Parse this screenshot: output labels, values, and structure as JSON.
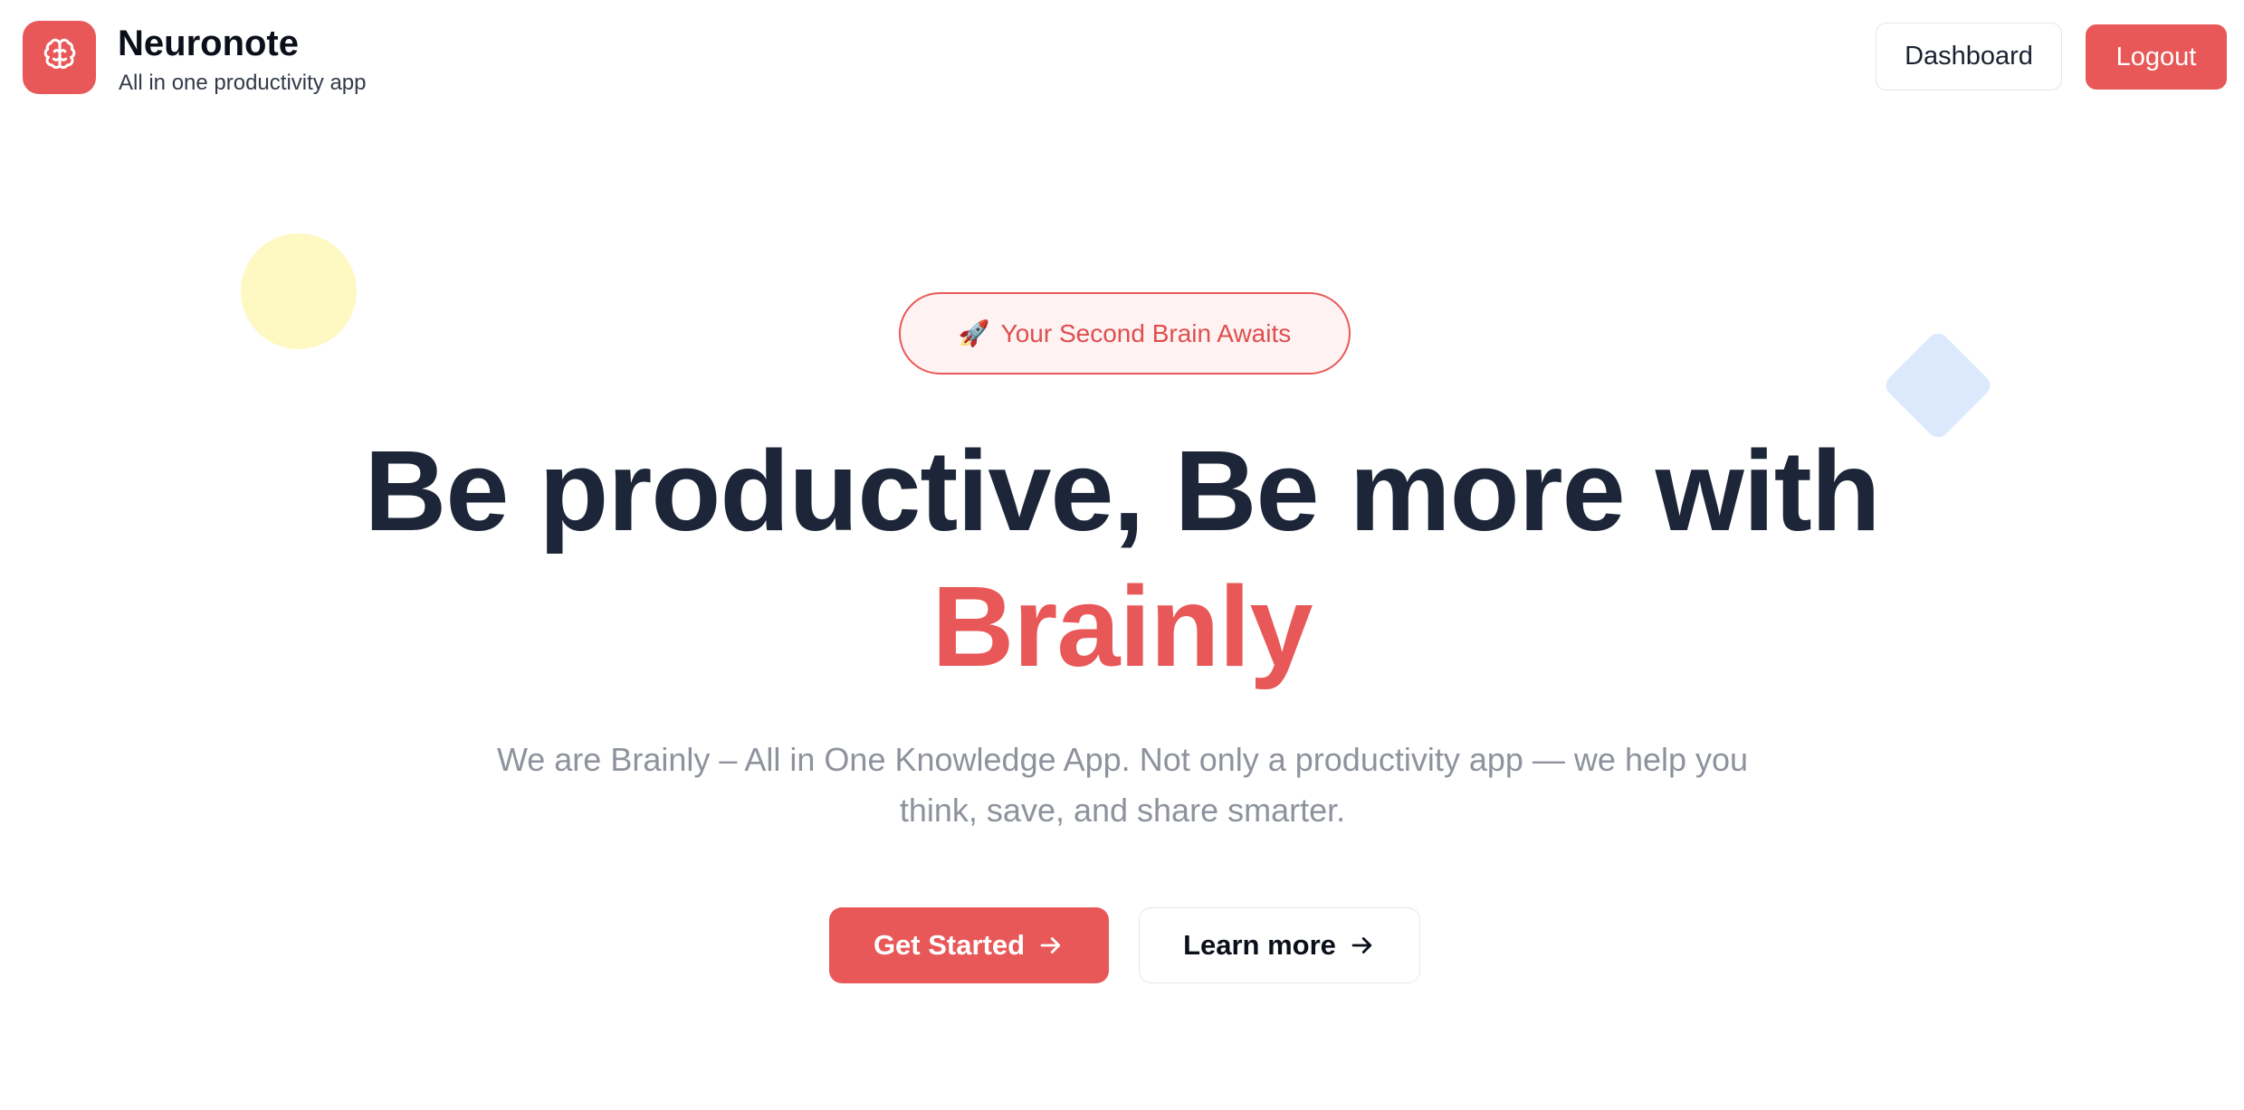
{
  "header": {
    "brand_name": "Neuronote",
    "brand_tagline": "All in one productivity app",
    "logo_icon": "brain-icon",
    "dashboard_label": "Dashboard",
    "logout_label": "Logout"
  },
  "hero": {
    "badge_icon": "🚀",
    "badge_text": "Your Second Brain Awaits",
    "headline": "Be productive, Be more with",
    "headline_accent": "Brainly",
    "subtitle": "We are Brainly – All in One Knowledge App. Not only a productivity app — we help you think, save, and share smarter.",
    "primary_cta": "Get Started",
    "secondary_cta": "Learn more"
  },
  "colors": {
    "accent": "#e85858",
    "heading": "#1d2638",
    "muted": "#8d929c",
    "deco_yellow": "#fef8c3",
    "deco_blue": "#dce9fd"
  }
}
